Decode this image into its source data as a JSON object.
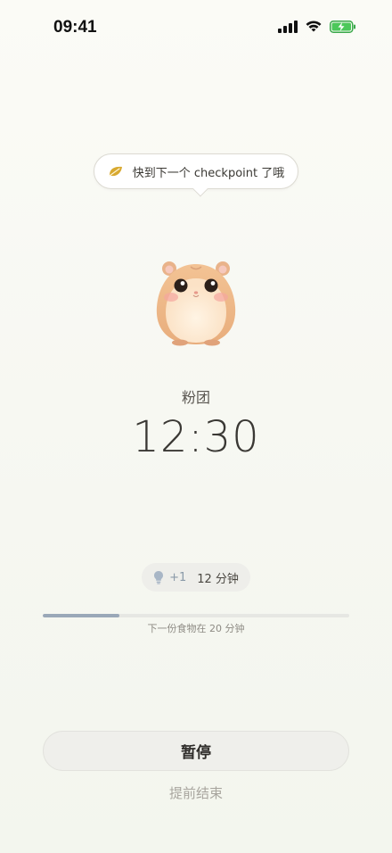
{
  "status_bar": {
    "time": "09:41"
  },
  "bubble": {
    "message": "快到下一个 checkpoint 了哦",
    "icon": "leaf-icon"
  },
  "pet": {
    "name": "粉团",
    "icon": "hamster-icon"
  },
  "timer": {
    "value": "12:30"
  },
  "reward": {
    "icon": "lightbulb-icon",
    "plus": "+1",
    "duration": "12 分钟"
  },
  "progress": {
    "fraction": 0.25,
    "caption": "下一份食物在 20 分钟"
  },
  "actions": {
    "pause_label": "暂停",
    "end_label": "提前结束"
  },
  "colors": {
    "accent": "#9aa8b8",
    "leaf": "#d4a52c",
    "background": "#f8f9f3"
  }
}
